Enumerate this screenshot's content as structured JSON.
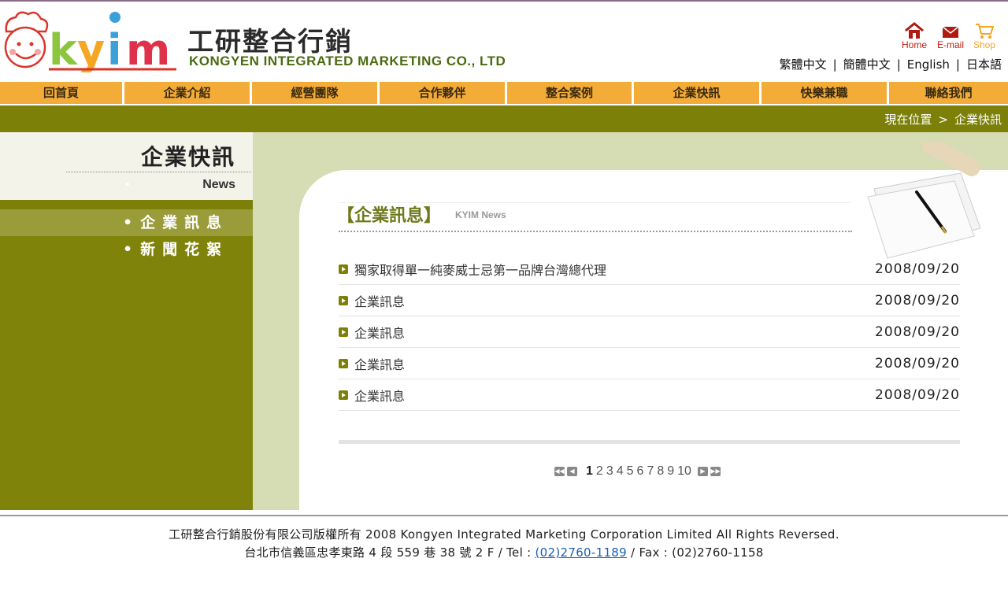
{
  "header": {
    "brand_cn": "工研整合行銷",
    "brand_en": "KONGYEN INTEGRATED MARKETING CO., LTD",
    "logo_text": "KYIM",
    "util": [
      {
        "label": "Home",
        "icon": "home-icon",
        "color": "#c41d12"
      },
      {
        "label": "E-mail",
        "icon": "mail-icon",
        "color": "#c41d12"
      },
      {
        "label": "Shop",
        "icon": "cart-icon",
        "color": "#f5a623"
      }
    ],
    "languages": [
      "繁體中文",
      "簡體中文",
      "English",
      "日本語"
    ],
    "lang_separator": "|"
  },
  "nav": {
    "items": [
      "回首頁",
      "企業介紹",
      "經營團隊",
      "合作夥伴",
      "整合案例",
      "企業快訊",
      "快樂兼職",
      "聯絡我們"
    ],
    "color": "#f4ac38"
  },
  "breadcrumb": {
    "label": "現在位置",
    "arrow": ">",
    "current": "企業快訊"
  },
  "sidebar": {
    "title": "企業快訊",
    "subtitle": "News",
    "items": [
      {
        "label": "企業訊息",
        "bullet": "•",
        "active": true
      },
      {
        "label": "新聞花絮",
        "bullet": "•",
        "active": false
      }
    ],
    "color": "#80830a"
  },
  "main": {
    "section_title": "【企業訊息】",
    "section_sub": "KYIM News",
    "news": [
      {
        "title": "獨家取得單一純麥威士忌第一品牌台灣總代理",
        "date": "2008/09/20"
      },
      {
        "title": "企業訊息",
        "date": "2008/09/20"
      },
      {
        "title": "企業訊息",
        "date": "2008/09/20"
      },
      {
        "title": "企業訊息",
        "date": "2008/09/20"
      },
      {
        "title": "企業訊息",
        "date": "2008/09/20"
      }
    ],
    "pager": {
      "pages": [
        "1",
        "2",
        "3",
        "4",
        "5",
        "6",
        "7",
        "8",
        "9",
        "10"
      ],
      "current": "1"
    }
  },
  "footer": {
    "line1": "工研整合行銷股份有限公司版權所有 2008 Kongyen Integrated Marketing Corporation Limited All Rights Reversed.",
    "line2_prefix": "台北市信義區忠孝東路 4 段 559 巷 38 號 2 F / Tel : ",
    "tel": "(02)2760-1189",
    "line2_suffix": " / Fax : (02)2760-1158"
  }
}
